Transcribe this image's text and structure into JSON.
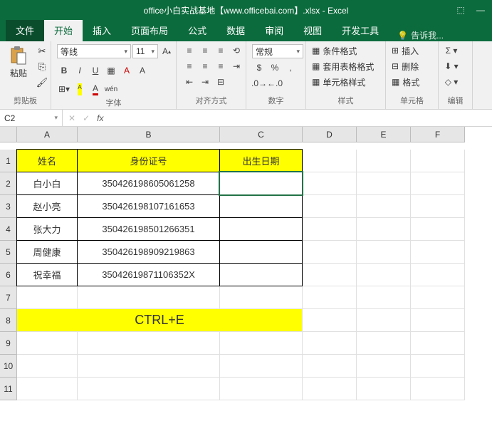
{
  "title": "office小白实战基地【www.officebai.com】.xlsx - Excel",
  "tabs": {
    "file": "文件",
    "home": "开始",
    "insert": "插入",
    "layout": "页面布局",
    "formula": "公式",
    "data": "数据",
    "review": "审阅",
    "view": "视图",
    "dev": "开发工具",
    "tellme": "告诉我..."
  },
  "ribbon": {
    "clipboard": {
      "label": "剪贴板",
      "paste": "粘贴"
    },
    "font": {
      "label": "字体",
      "name": "等线",
      "size": "11"
    },
    "align": {
      "label": "对齐方式"
    },
    "number": {
      "label": "数字",
      "format": "常规"
    },
    "styles": {
      "label": "样式",
      "cond": "条件格式",
      "table": "套用表格格式",
      "cell": "单元格样式"
    },
    "cells": {
      "label": "单元格",
      "insert": "插入",
      "delete": "删除",
      "format": "格式"
    },
    "editing": {
      "label": "编辑"
    }
  },
  "namebox": "C2",
  "chart_data": {
    "type": "table",
    "columns": [
      "A",
      "B",
      "C",
      "D",
      "E",
      "F"
    ],
    "headers": {
      "A": "姓名",
      "B": "身份证号",
      "C": "出生日期"
    },
    "rows": [
      {
        "A": "白小白",
        "B": "350426198605061258",
        "C": ""
      },
      {
        "A": "赵小亮",
        "B": "350426198107161653",
        "C": ""
      },
      {
        "A": "张大力",
        "B": "350426198501266351",
        "C": ""
      },
      {
        "A": "周健康",
        "B": "350426198909219863",
        "C": ""
      },
      {
        "A": "祝幸福",
        "B": "35042619871106352X",
        "C": ""
      }
    ],
    "note": "CTRL+E"
  },
  "rows": [
    "1",
    "2",
    "3",
    "4",
    "5",
    "6",
    "7",
    "8",
    "9",
    "10",
    "11"
  ]
}
